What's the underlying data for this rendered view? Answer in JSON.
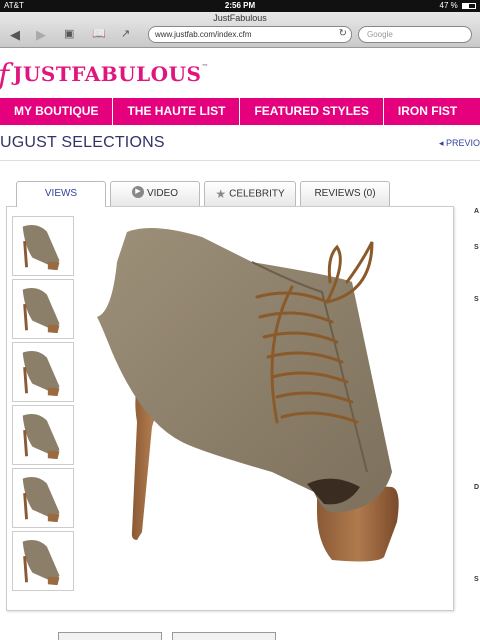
{
  "status_bar": {
    "carrier": "AT&T",
    "time": "2:56 PM",
    "battery": "47 %",
    "battery_level": 0.47
  },
  "browser": {
    "page_title": "JustFabulous",
    "url": "www.justfab.com/index.cfm",
    "search_placeholder": "Google"
  },
  "site": {
    "logo_text": "JUSTFABULOUS",
    "logo_tm": "™",
    "nav": [
      "MY BOUTIQUE",
      "THE HAUTE LIST",
      "FEATURED STYLES",
      "IRON FIST"
    ],
    "section_title": "UGUST SELECTIONS",
    "prev_link": "◂ PREVIO"
  },
  "tabs": [
    {
      "label": "VIEWS",
      "active": true
    },
    {
      "label": "VIDEO",
      "icon": "play-icon"
    },
    {
      "label": "CELEBRITY",
      "icon": "star-icon"
    },
    {
      "label": "REVIEWS (0)"
    }
  ],
  "thumbnails": [
    "shoe-view-side",
    "shoe-view-angle",
    "shoe-view-back",
    "shoe-view-front",
    "shoe-view-closeup",
    "shoe-view-worn"
  ],
  "right_column_labels": [
    "A",
    "S",
    "S",
    "D",
    "S"
  ],
  "colors": {
    "brand_pink": "#e5007e",
    "title_navy": "#333366",
    "link_blue": "#33439a"
  }
}
